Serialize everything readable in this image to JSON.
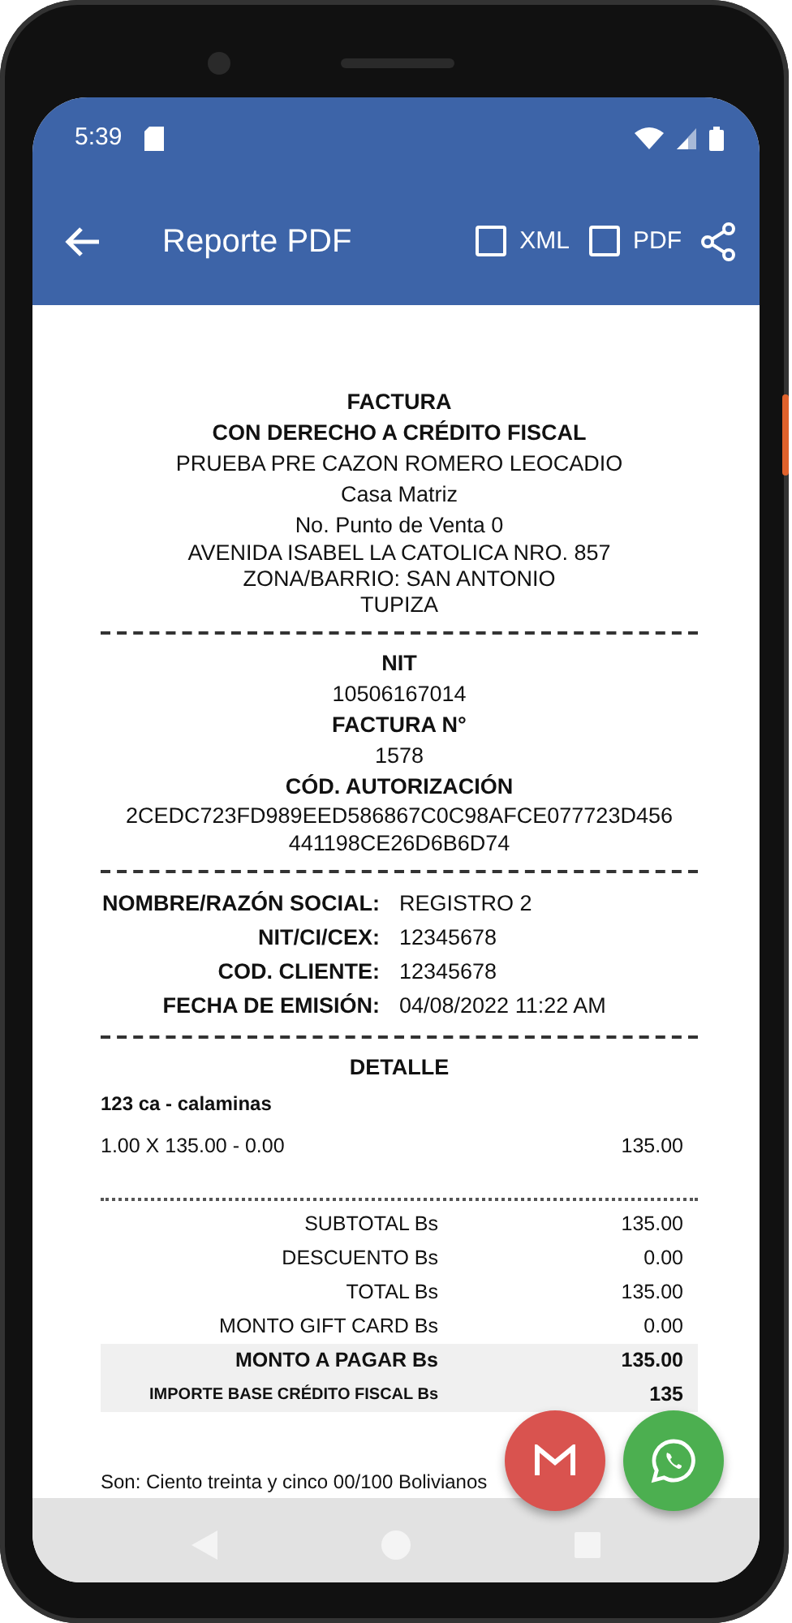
{
  "status_bar": {
    "time": "5:39"
  },
  "app_bar": {
    "title": "Reporte PDF",
    "options": [
      {
        "label": "XML",
        "checked": false
      },
      {
        "label": "PDF",
        "checked": false
      }
    ]
  },
  "issuer": {
    "lines": [
      {
        "text": "FACTURA",
        "bold": true
      },
      {
        "text": "CON DERECHO A CRÉDITO FISCAL",
        "bold": true
      },
      {
        "text": "PRUEBA PRE CAZON ROMERO LEOCADIO",
        "bold": false
      },
      {
        "text": "Casa Matriz",
        "bold": false
      },
      {
        "text": "No. Punto de Venta 0",
        "bold": false
      },
      {
        "text": "AVENIDA ISABEL LA CATOLICA NRO. 857",
        "bold": false
      },
      {
        "text": "ZONA/BARRIO: SAN ANTONIO",
        "bold": false
      },
      {
        "text": "TUPIZA",
        "bold": false
      }
    ]
  },
  "identifiers": [
    {
      "label": "NIT",
      "value_lines": [
        "10506167014"
      ]
    },
    {
      "label": "FACTURA N°",
      "value_lines": [
        "1578"
      ]
    },
    {
      "label": "CÓD. AUTORIZACIÓN",
      "value_lines": [
        "2CEDC723FD989EED586867C0C98AFCE077723D456",
        "441198CE26D6B6D74"
      ]
    }
  ],
  "customer": {
    "rows": [
      {
        "label": "NOMBRE/RAZÓN SOCIAL:",
        "value": "REGISTRO 2"
      },
      {
        "label": "NIT/CI/CEX:",
        "value": "12345678"
      },
      {
        "label": "COD. CLIENTE:",
        "value": "12345678"
      },
      {
        "label": "FECHA DE EMISIÓN:",
        "value": "04/08/2022 11:22 AM"
      }
    ]
  },
  "detail": {
    "title": "DETALLE",
    "items": [
      {
        "name": "123 ca - calaminas",
        "line": "1.00 X 135.00 - 0.00",
        "amount": "135.00"
      }
    ]
  },
  "totals": [
    {
      "label": "SUBTOTAL Bs",
      "value": "135.00",
      "kind": "plain"
    },
    {
      "label": "DESCUENTO Bs",
      "value": "0.00",
      "kind": "plain"
    },
    {
      "label": "TOTAL Bs",
      "value": "135.00",
      "kind": "plain"
    },
    {
      "label": "MONTO GIFT CARD Bs",
      "value": "0.00",
      "kind": "plain"
    },
    {
      "label": "MONTO A PAGAR Bs",
      "value": "135.00",
      "kind": "highlight"
    },
    {
      "label": "IMPORTE BASE CRÉDITO FISCAL Bs",
      "value": "135",
      "kind": "base"
    }
  ],
  "footer": {
    "amount_in_words": "Son: Ciento treinta y cinco 00/100 Bolivianos"
  },
  "actions": [
    {
      "kind": "email"
    },
    {
      "kind": "whatsapp"
    }
  ]
}
